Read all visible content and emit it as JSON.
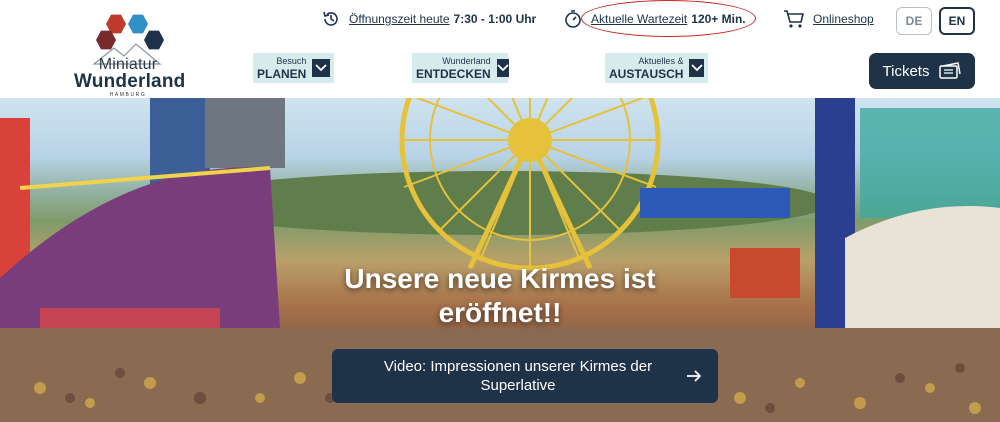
{
  "logo": {
    "line1": "Miniatur",
    "line2": "Wunderland",
    "line3": "HAMBURG"
  },
  "infobar": {
    "hours_link": "Öffnungszeit heute",
    "hours_value": "7:30 - 1:00 Uhr",
    "wait_link": "Aktuelle Wartezeit",
    "wait_value": "120+ Min.",
    "shop_link": "Onlineshop"
  },
  "languages": [
    {
      "code": "DE",
      "active": false
    },
    {
      "code": "EN",
      "active": true
    }
  ],
  "nav": [
    {
      "small": "Besuch",
      "big": "PLANEN"
    },
    {
      "small": "Wunderland",
      "big": "ENTDECKEN"
    },
    {
      "small": "Aktuelles &",
      "big": "AUSTAUSCH"
    }
  ],
  "tickets_label": "Tickets",
  "hero": {
    "title": "Unsere neue Kirmes ist eröffnet!!",
    "button_label": "Video: Impressionen unserer Kirmes der Superlative"
  },
  "colors": {
    "navy": "#1e3248",
    "nav_bg": "#d6ecec",
    "annotation": "#c62828"
  },
  "icons": [
    "clock-history-icon",
    "stopwatch-icon",
    "cart-icon",
    "chevron-down-icon",
    "ticket-icon",
    "arrow-right-icon"
  ]
}
